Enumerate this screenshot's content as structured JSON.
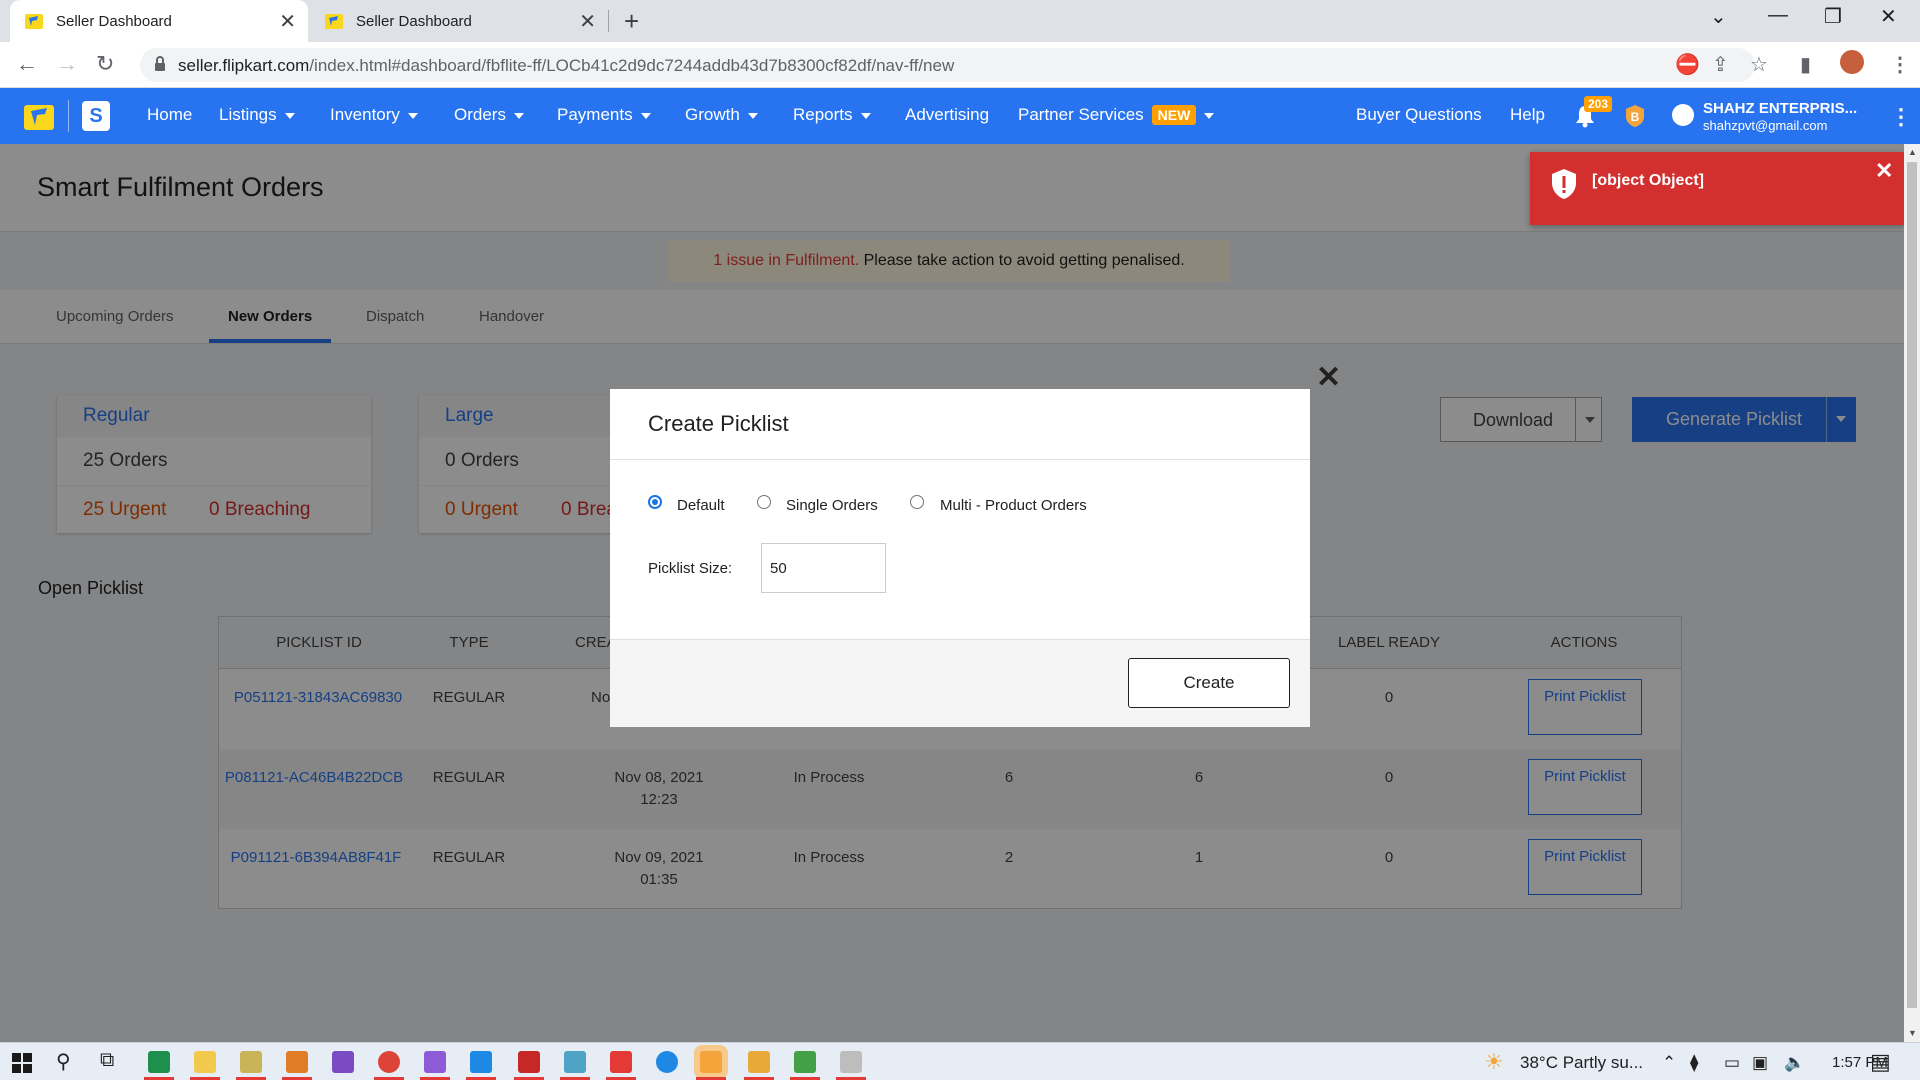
{
  "browser": {
    "tabs": [
      {
        "title": "Seller Dashboard",
        "active": true
      },
      {
        "title": "Seller Dashboard",
        "active": false
      }
    ],
    "url_host": "seller.flipkart.com",
    "url_path": "/index.html#dashboard/fbflite-ff/LOCb41c2d9dc7244addb43d7b8300cf82df/nav-ff/new"
  },
  "header": {
    "nav": [
      {
        "label": "Home"
      },
      {
        "label": "Listings"
      },
      {
        "label": "Inventory"
      },
      {
        "label": "Orders"
      },
      {
        "label": "Payments"
      },
      {
        "label": "Growth"
      },
      {
        "label": "Reports"
      },
      {
        "label": "Advertising"
      },
      {
        "label": "Partner Services"
      }
    ],
    "new_badge": "NEW",
    "buyer_questions": "Buyer Questions",
    "help": "Help",
    "notification_count": "203",
    "user_name": "SHAHZ ENTERPRIS...",
    "user_email": "shahzpvt@gmail.com",
    "brand_color": "#2874f0"
  },
  "page": {
    "title": "Smart Fulfilment Orders",
    "issue_count_text": "1 issue in Fulfilment.",
    "issue_action_text": "Please take action to avoid getting penalised.",
    "tabs": [
      {
        "label": "Upcoming Orders",
        "active": false
      },
      {
        "label": "New Orders",
        "active": true
      },
      {
        "label": "Dispatch",
        "active": false
      },
      {
        "label": "Handover",
        "active": false
      }
    ],
    "cards": [
      {
        "title": "Regular",
        "orders": "25 Orders",
        "urgent": "25 Urgent",
        "breaching": "0 Breaching"
      },
      {
        "title": "Large",
        "orders": "0 Orders",
        "urgent": "0 Urgent",
        "breaching": "0 Brea"
      }
    ],
    "download_label": "Download",
    "generate_label": "Generate Picklist",
    "open_picklist_label": "Open Picklist"
  },
  "table": {
    "headers": [
      "PICKLIST ID",
      "TYPE",
      "CREA",
      "LABEL READY",
      "ACTIONS"
    ],
    "rows": [
      {
        "id": "P051121-31843AC69830",
        "type": "REGULAR",
        "created": "No",
        "created_time": "",
        "status": "",
        "c1": "",
        "c2": "",
        "label_ready": "0",
        "action": "Print Picklist"
      },
      {
        "id": "P081121-AC46B4B22DCB",
        "type": "REGULAR",
        "created": "Nov 08, 2021",
        "created_time": "12:23",
        "status": "In Process",
        "c1": "6",
        "c2": "6",
        "label_ready": "0",
        "action": "Print Picklist"
      },
      {
        "id": "P091121-6B394AB8F41F",
        "type": "REGULAR",
        "created": "Nov 09, 2021",
        "created_time": "01:35",
        "status": "In Process",
        "c1": "2",
        "c2": "1",
        "label_ready": "0",
        "action": "Print Picklist"
      }
    ]
  },
  "modal": {
    "title": "Create Picklist",
    "options": [
      {
        "label": "Default",
        "checked": true
      },
      {
        "label": "Single Orders",
        "checked": false
      },
      {
        "label": "Multi - Product Orders",
        "checked": false
      }
    ],
    "size_label": "Picklist Size:",
    "size_value": "50",
    "create_label": "Create"
  },
  "toast": {
    "message": "[object Object]",
    "color": "#d32f2f"
  },
  "taskbar": {
    "weather": "38°C  Partly su...",
    "time": "1:57 PM"
  }
}
